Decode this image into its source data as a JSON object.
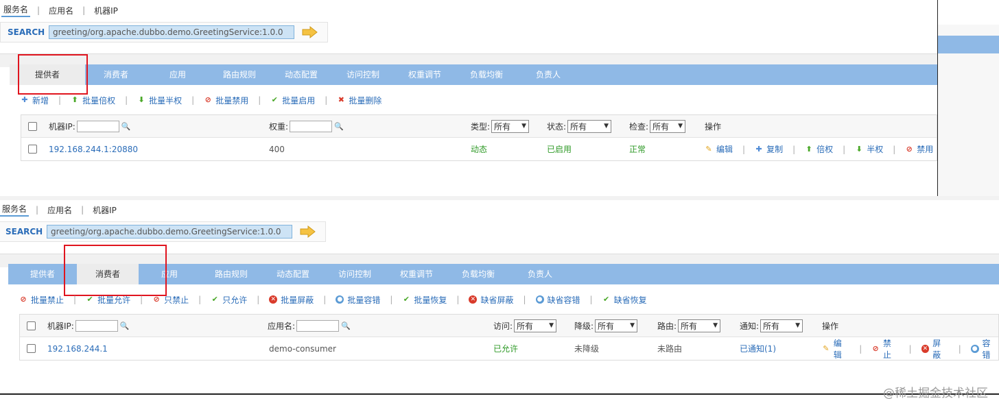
{
  "top_nav": [
    "服务名",
    "应用名",
    "机器IP"
  ],
  "search": {
    "label": "SEARCH",
    "value": "greeting/org.apache.dubbo.demo.GreetingService:1.0.0"
  },
  "tabs": [
    "提供者",
    "消费者",
    "应用",
    "路由规则",
    "动态配置",
    "访问控制",
    "权重调节",
    "负载均衡",
    "负责人"
  ],
  "providers": {
    "actions": [
      "新增",
      "批量倍权",
      "批量半权",
      "批量禁用",
      "批量启用",
      "批量删除"
    ],
    "headers": {
      "ip": "机器IP:",
      "weight": "权重:",
      "type": "类型:",
      "type_value": "所有",
      "status": "状态:",
      "status_value": "所有",
      "check": "检查:",
      "check_value": "所有",
      "ops": "操作"
    },
    "row": {
      "ip": "192.168.244.1:20880",
      "weight": "400",
      "type": "动态",
      "status": "已启用",
      "check": "正常",
      "ops": [
        "编辑",
        "复制",
        "倍权",
        "半权",
        "禁用"
      ]
    }
  },
  "consumers": {
    "actions": [
      "批量禁止",
      "批量允许",
      "只禁止",
      "只允许",
      "批量屏蔽",
      "批量容错",
      "批量恢复",
      "缺省屏蔽",
      "缺省容错",
      "缺省恢复"
    ],
    "headers": {
      "ip": "机器IP:",
      "app": "应用名:",
      "access": "访问:",
      "access_value": "所有",
      "degrade": "降级:",
      "degrade_value": "所有",
      "route": "路由:",
      "route_value": "所有",
      "notify": "通知:",
      "notify_value": "所有",
      "ops": "操作"
    },
    "row": {
      "ip": "192.168.244.1",
      "app": "demo-consumer",
      "access": "已允许",
      "degrade": "未降级",
      "route": "未路由",
      "notify": "已通知(1)",
      "ops": [
        "编辑",
        "禁止",
        "屏蔽",
        "容错"
      ]
    }
  },
  "watermark": "@稀土掘金技术社区",
  "colors": {
    "tab_bar": "#8fb9e6",
    "link": "#2a6cb8",
    "green": "#2f9a27",
    "highlight_box": "#e0141e"
  }
}
